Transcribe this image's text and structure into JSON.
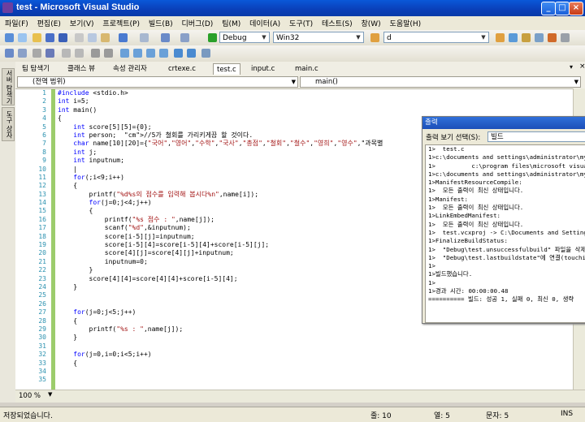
{
  "window": {
    "title": "test - Microsoft Visual Studio"
  },
  "menu": [
    "파일(F)",
    "편집(E)",
    "보기(V)",
    "프로젝트(P)",
    "빌드(B)",
    "디버그(D)",
    "팀(M)",
    "데이터(A)",
    "도구(T)",
    "테스트(S)",
    "창(W)",
    "도움말(H)"
  ],
  "toolbar": {
    "config": "Debug",
    "platform": "Win32",
    "find": "d"
  },
  "sidebar": {
    "tab1": "서버 탐색기",
    "tab2": "도구 상자"
  },
  "tabs": [
    {
      "label": "팀 탐색기"
    },
    {
      "label": "클래스 뷰"
    },
    {
      "label": "속성 관리자"
    },
    {
      "label": "crtexe.c"
    },
    {
      "label": "test.c",
      "active": true
    },
    {
      "label": "input.c"
    },
    {
      "label": "main.c"
    }
  ],
  "nav": {
    "scope": "(전역 범위)",
    "member": "main()"
  },
  "editor": {
    "line_numbers": [
      "1",
      "2",
      "3",
      "4",
      "5",
      "6",
      "7",
      "8",
      "9",
      "10",
      "11",
      "12",
      "13",
      "14",
      "15",
      "16",
      "17",
      "18",
      "19",
      "20",
      "21",
      "22",
      "23",
      "24",
      "25",
      "26",
      "27",
      "28",
      "29",
      "30",
      "31",
      "32",
      "33",
      "34",
      "35"
    ],
    "lines": [
      "#include <stdio.h>",
      "int i=5;",
      "int main()",
      "{",
      "    int score[5][5]={0};",
      "    int person;  //5가 철회를 가리키게끔 할 것이다.",
      "    char name[10][20]={\"국어\",\"영어\",\"수학\",\"국사\",\"총점\",\"철회\",\"철수\",\"영희\",\"영수\",\"과목별",
      "    int j;",
      "    int inputnum;",
      "    |",
      "    for(;i<9;i++)",
      "    {",
      "        printf(\"%d%s의 점수를 입력해 봅시다%n\",name[i]);",
      "        for(j=0;j<4;j++)",
      "        {",
      "            printf(\"%s 점수 : \",name[j]);",
      "            scanf(\"%d\",&inputnum);",
      "            score[i-5][j]=inputnum;",
      "            score[i-5][4]=score[i-5][4]+score[i-5][j];",
      "            score[4][j]=score[4][j]+inputnum;",
      "            inputnum=0;",
      "        }",
      "        score[4][4]=score[4][4]+score[i-5][4];",
      "    }",
      "",
      "",
      "    for(j=0;j<5;j++)",
      "    {",
      "        printf(\"%s : \",name[j]);",
      "    }",
      "",
      "    for(j=0,i=0;i<5;i++)",
      "    {",
      "",
      ""
    ]
  },
  "zoom": "100 %",
  "output": {
    "title": "출력",
    "source_label": "출력 보기 선택(S):",
    "source_value": "빌드",
    "lines": [
      "1>  test.c",
      "1>c:\\documents and settings\\administrator\\my",
      "1>          c:\\program files\\microsoft visual",
      "1>c:\\documents and settings\\administrator\\my",
      "1>ManifestResourceCompile:",
      "1>  모든 출력이 최신 상태입니다.",
      "1>Manifest:",
      "1>  모든 출력이 최신 상태입니다.",
      "1>LinkEmbedManifest:",
      "1>  모든 출력이 최신 상태입니다.",
      "1>  test.vcxproj -> C:\\Documents and Settings",
      "1>FinalizeBuildStatus:",
      "1>  \"Debug\\test.unsuccessfulbuild\" 파일을 삭제",
      "1>  \"Debug\\test.lastbuildstate\"에 연결(touchi",
      "1>",
      "1>빌드했습니다.",
      "1>",
      "1>경과 시간: 00:00:00.48",
      "========== 빌드: 성공 1, 실패 0, 최신 0, 생략"
    ]
  },
  "status": {
    "message": "저장되었습니다.",
    "line": "줄: 10",
    "col": "열: 5",
    "ch": "문자: 5",
    "mode": "INS"
  }
}
